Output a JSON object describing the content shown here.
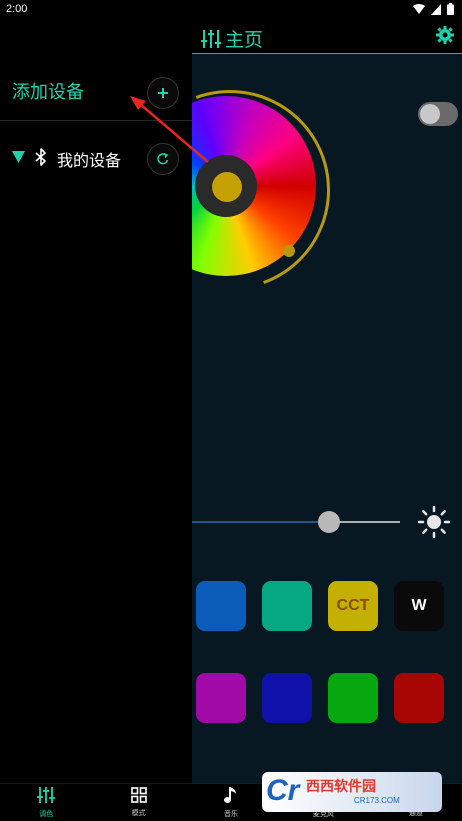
{
  "status_bar": {
    "time": "2:00"
  },
  "header": {
    "title": "主页"
  },
  "drawer": {
    "add_device_label": "添加设备",
    "my_devices_label": "我的设备"
  },
  "swatches": [
    {
      "label": "",
      "color": "#0a5cb8",
      "text_color": "#ffffff"
    },
    {
      "label": "",
      "color": "#06a883",
      "text_color": "#ffffff"
    },
    {
      "label": "CCT",
      "color": "#c3b002",
      "text_color": "#8a4a05"
    },
    {
      "label": "W",
      "color": "#0a0a0a",
      "text_color": "#ffffff"
    },
    {
      "label": "",
      "color": "#a20aa8",
      "text_color": "#ffffff"
    },
    {
      "label": "",
      "color": "#1010aa",
      "text_color": "#ffffff"
    },
    {
      "label": "",
      "color": "#07a80f",
      "text_color": "#ffffff"
    },
    {
      "label": "",
      "color": "#a80505",
      "text_color": "#ffffff"
    }
  ],
  "brightness": {
    "level_fraction": 0.66
  },
  "bottom_nav": [
    {
      "label": "调色",
      "icon": "sliders-icon",
      "active": true
    },
    {
      "label": "模式",
      "icon": "grid-icon",
      "active": false
    },
    {
      "label": "音乐",
      "icon": "music-note-icon",
      "active": false
    },
    {
      "label": "麦克风",
      "icon": "microphone-icon",
      "active": false
    },
    {
      "label": "通道",
      "icon": "channel-icon",
      "active": false
    }
  ],
  "watermark": {
    "logo": "Cr",
    "text": "西西软件园",
    "sub": "CR173.COM"
  },
  "colors": {
    "accent": "#1fd3ad",
    "ring": "#b89a10",
    "background": "#071823"
  }
}
